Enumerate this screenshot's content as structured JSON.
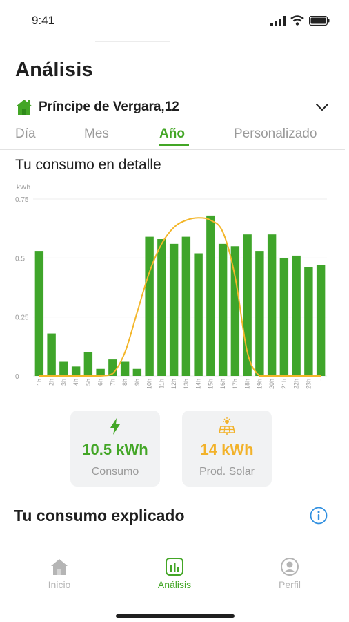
{
  "status": {
    "time": "9:41"
  },
  "page": {
    "title": "Análisis"
  },
  "address": {
    "text": "Príncipe de Vergara,12"
  },
  "tabs": [
    {
      "label": "Día"
    },
    {
      "label": "Mes"
    },
    {
      "label": "Año",
      "active": true
    },
    {
      "label": "Personalizado"
    }
  ],
  "section": {
    "subtitle": "Tu consumo en detalle"
  },
  "chart_data": {
    "type": "bar",
    "ylabel": "kWh",
    "ylim": [
      0,
      0.75
    ],
    "yticks": [
      "0",
      "0.25",
      "0.5",
      "0.75"
    ],
    "categories": [
      "1h",
      "2h",
      "3h",
      "4h",
      "5h",
      "6h",
      "7h",
      "8h",
      "9h",
      "10h",
      "11h",
      "12h",
      "13h",
      "14h",
      "15h",
      "16h",
      "17h",
      "18h",
      "19h",
      "20h",
      "21h",
      "22h",
      "23h",
      "-"
    ],
    "values": [
      0.53,
      0.18,
      0.06,
      0.04,
      0.1,
      0.03,
      0.07,
      0.06,
      0.03,
      0.59,
      0.58,
      0.56,
      0.59,
      0.52,
      0.68,
      0.56,
      0.55,
      0.6,
      0.53,
      0.6,
      0.5,
      0.51,
      0.46,
      0.47
    ],
    "overlay_line": [
      0,
      0,
      0,
      0,
      0,
      0,
      0.01,
      0.1,
      0.27,
      0.44,
      0.56,
      0.63,
      0.66,
      0.67,
      0.66,
      0.61,
      0.42,
      0.1,
      0,
      0,
      0,
      0,
      0,
      0
    ],
    "colors": {
      "bars": "#3fa52a",
      "line": "#f3b62a",
      "grid": "#ececec"
    },
    "grid": true
  },
  "cards": {
    "consumo": {
      "value": "10.5 kWh",
      "label": "Consumo",
      "color": "#43a626",
      "icon": "lightning-icon"
    },
    "solar": {
      "value": "14 kWh",
      "label": "Prod. Solar",
      "color": "#f2b22a",
      "icon": "solar-panel-icon"
    }
  },
  "explain": {
    "title": "Tu consumo explicado"
  },
  "nav": [
    {
      "label": "Inicio"
    },
    {
      "label": "Análisis",
      "active": true
    },
    {
      "label": "Perfil"
    }
  ]
}
